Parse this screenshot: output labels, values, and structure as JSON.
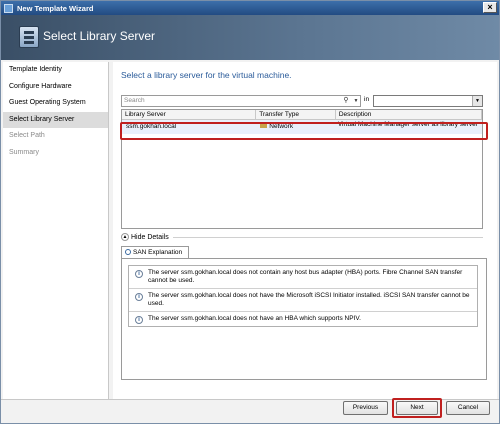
{
  "window": {
    "title": "New Template Wizard",
    "close_glyph": "×"
  },
  "banner": {
    "title": "Select Library Server",
    "icon": "template-wizard-icon"
  },
  "nav": {
    "items": [
      {
        "label": "Template Identity",
        "state": "normal"
      },
      {
        "label": "Configure Hardware",
        "state": "normal"
      },
      {
        "label": "Guest Operating System",
        "state": "normal"
      },
      {
        "label": "Select Library Server",
        "state": "active"
      },
      {
        "label": "Select Path",
        "state": "disabled"
      },
      {
        "label": "Summary",
        "state": "disabled"
      }
    ]
  },
  "main": {
    "heading": "Select a library server for the virtual machine.",
    "search": {
      "placeholder": "Search",
      "in_label": "in",
      "in_value": ""
    }
  },
  "grid": {
    "columns": [
      "Library Server",
      "Transfer Type",
      "Description"
    ],
    "rows": [
      {
        "server": "ssm.gokhan.local",
        "transfer_type": "Network",
        "description": "Virtual Machine Manager server as library server"
      }
    ]
  },
  "details": {
    "toggle_label": "Hide Details",
    "tab_label": "SAN Explanation",
    "messages": [
      "The server ssm.gokhan.local does not contain any host bus adapter (HBA) ports. Fibre Channel SAN transfer cannot be used.",
      "The server ssm.gokhan.local does not have the Microsoft iSCSI Initiator installed. iSCSI SAN transfer cannot be used.",
      "The server ssm.gokhan.local does not have an HBA which supports NPIV."
    ]
  },
  "footer": {
    "previous": "Previous",
    "next": "Next",
    "cancel": "Cancel"
  },
  "colors": {
    "accent": "#2a5b9a",
    "highlight": "#c0201f",
    "banner": "#4a627d"
  }
}
